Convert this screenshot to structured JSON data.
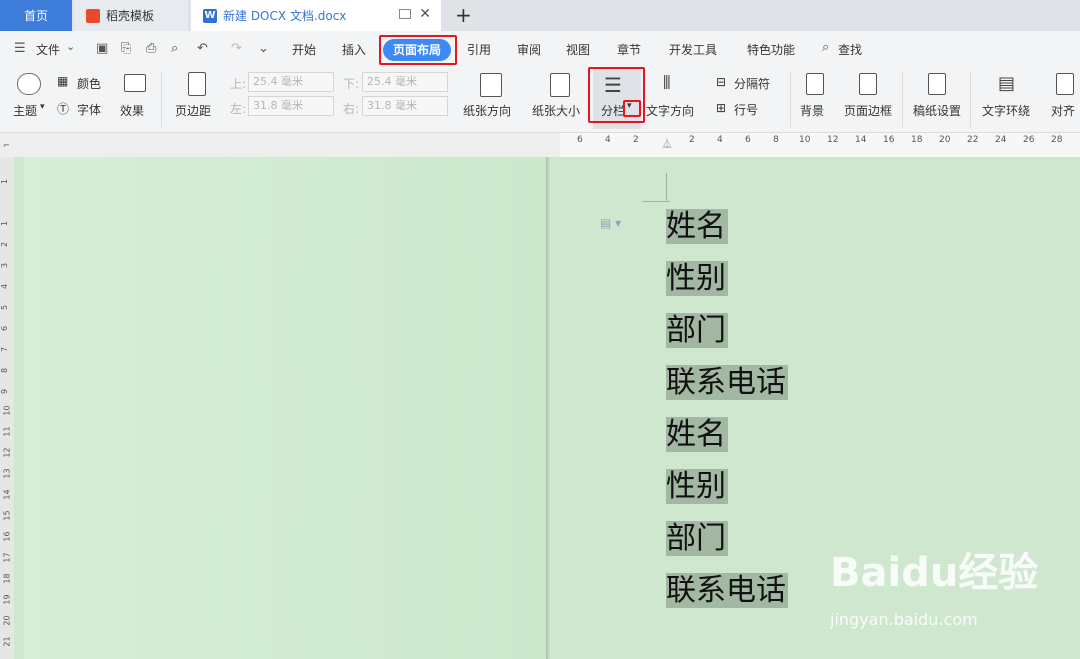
{
  "tabs": {
    "home": "首页",
    "daoke": "稻壳模板",
    "doc": "新建 DOCX 文档.docx",
    "new_tab": "+"
  },
  "menu": {
    "file": "文件",
    "items": [
      "开始",
      "插入",
      "页面布局",
      "引用",
      "审阅",
      "视图",
      "章节",
      "开发工具",
      "特色功能",
      "查找"
    ]
  },
  "ribbon": {
    "theme": "主题",
    "color": "颜色",
    "font": "字体",
    "effect": "效果",
    "margins": "页边距",
    "top_label": "上:",
    "bottom_label": "下:",
    "left_label": "左:",
    "right_label": "右:",
    "top_value": "25.4 毫米",
    "bottom_value": "25.4 毫米",
    "left_value": "31.8 毫米",
    "right_value": "31.8 毫米",
    "orientation": "纸张方向",
    "size": "纸张大小",
    "columns": "分栏",
    "text_direction": "文字方向",
    "breaks": "分隔符",
    "line_numbers": "行号",
    "background": "背景",
    "page_border": "页面边框",
    "manuscript": "稿纸设置",
    "wrap_text": "文字环绕",
    "align": "对齐"
  },
  "ruler": {
    "top_ticks": [
      "6",
      "4",
      "2",
      "2",
      "4",
      "6",
      "8",
      "10",
      "12",
      "14",
      "16",
      "18",
      "20",
      "22",
      "24",
      "26",
      "28"
    ],
    "left_ticks": [
      "1",
      "1",
      "2",
      "3",
      "4",
      "5",
      "6",
      "7",
      "8",
      "9",
      "10",
      "11",
      "12",
      "13",
      "14",
      "15",
      "16",
      "17",
      "18",
      "19",
      "20",
      "21"
    ]
  },
  "document": {
    "lines": [
      "姓名",
      "性别",
      "部门",
      "联系电话",
      "姓名",
      "性别",
      "部门",
      "联系电话"
    ]
  },
  "watermark": {
    "logo": "Baidu经验",
    "url": "jingyan.baidu.com"
  }
}
